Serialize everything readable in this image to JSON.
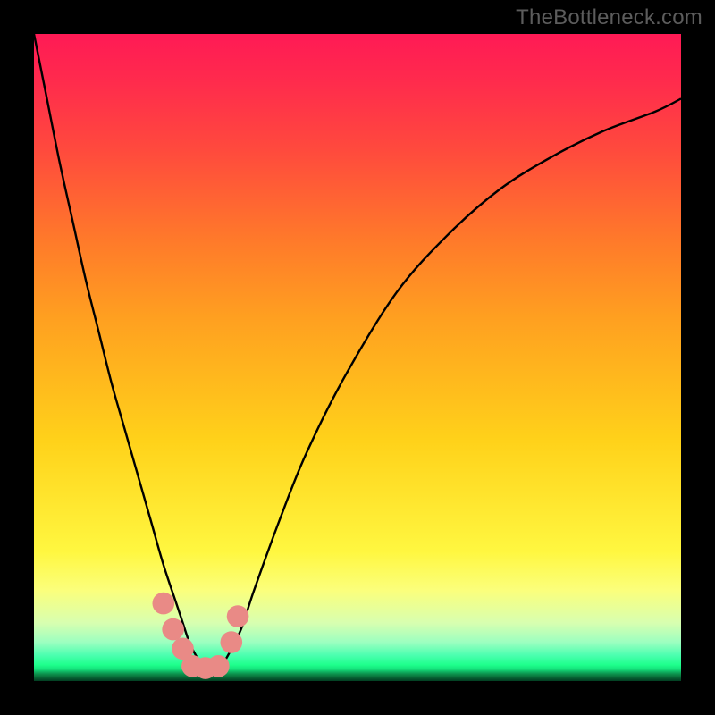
{
  "attribution": "TheBottleneck.com",
  "chart_data": {
    "type": "line",
    "title": "",
    "xlabel": "",
    "ylabel": "",
    "xlim": [
      0,
      100
    ],
    "ylim": [
      0,
      100
    ],
    "grid": false,
    "background_gradient": {
      "orientation": "vertical",
      "stops": [
        {
          "pos": 0.0,
          "color": "#ff1a55"
        },
        {
          "pos": 0.18,
          "color": "#ff4a3d"
        },
        {
          "pos": 0.44,
          "color": "#ffa020"
        },
        {
          "pos": 0.8,
          "color": "#fff740"
        },
        {
          "pos": 0.92,
          "color": "#c8ffb0"
        },
        {
          "pos": 0.97,
          "color": "#2cff92"
        },
        {
          "pos": 1.0,
          "color": "#033f22"
        }
      ]
    },
    "series": [
      {
        "name": "bottleneck-curve",
        "color": "#000000",
        "x": [
          0,
          2,
          4,
          6,
          8,
          10,
          12,
          14,
          16,
          18,
          20,
          22,
          23,
          24,
          25,
          26,
          27,
          28,
          29,
          30,
          32,
          34,
          38,
          42,
          48,
          56,
          64,
          72,
          80,
          88,
          96,
          100
        ],
        "y": [
          100,
          90,
          80,
          71,
          62,
          54,
          46,
          39,
          32,
          25,
          18,
          12,
          9,
          6,
          4,
          2.5,
          2,
          2,
          2.5,
          4,
          8,
          14,
          25,
          35,
          47,
          60,
          69,
          76,
          81,
          85,
          88,
          90
        ]
      }
    ],
    "markers": [
      {
        "name": "marker-left-1",
        "x": 20.0,
        "y": 12.0,
        "color": "#e98a86",
        "r": 1.7
      },
      {
        "name": "marker-left-2",
        "x": 21.5,
        "y": 8.0,
        "color": "#e98a86",
        "r": 1.7
      },
      {
        "name": "marker-left-3",
        "x": 23.0,
        "y": 5.0,
        "color": "#e98a86",
        "r": 1.7
      },
      {
        "name": "marker-floor-1",
        "x": 24.5,
        "y": 2.3,
        "color": "#e98a86",
        "r": 1.7
      },
      {
        "name": "marker-floor-2",
        "x": 26.5,
        "y": 2.0,
        "color": "#e98a86",
        "r": 1.7
      },
      {
        "name": "marker-floor-3",
        "x": 28.5,
        "y": 2.3,
        "color": "#e98a86",
        "r": 1.7
      },
      {
        "name": "marker-right-1",
        "x": 30.5,
        "y": 6.0,
        "color": "#e98a86",
        "r": 1.7
      },
      {
        "name": "marker-right-2",
        "x": 31.5,
        "y": 10.0,
        "color": "#e98a86",
        "r": 1.7
      }
    ]
  }
}
